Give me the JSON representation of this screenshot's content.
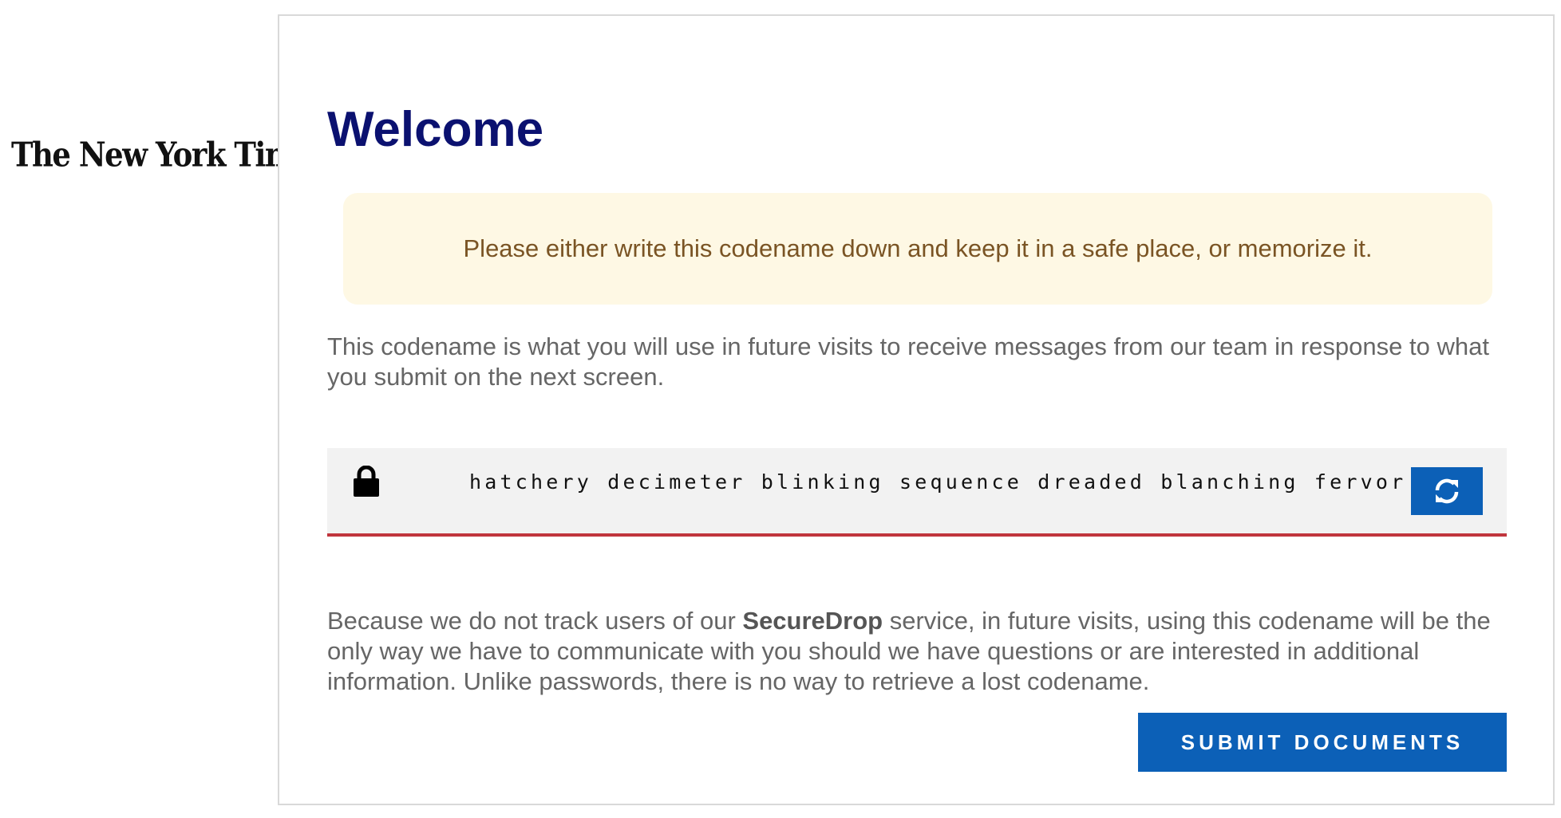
{
  "logo": {
    "text": "The New York Times"
  },
  "header": {
    "title": "Welcome"
  },
  "notice": {
    "text": "Please either write this codename down and keep it in a safe place, or memorize it."
  },
  "intro": {
    "text": "This codename is what you will use in future visits to receive messages from our team in response to what you submit on the next screen."
  },
  "codename": {
    "value": "hatchery decimeter blinking sequence dreaded blanching fervor",
    "lock_icon": "lock-icon",
    "refresh_icon": "refresh-icon"
  },
  "explanation": {
    "before": "Because we do not track users of our ",
    "brand": "SecureDrop",
    "after": " service, in future visits, using this codename will be the only way we have to communicate with you should we have questions or are interested in additional information. Unlike passwords, there is no way to retrieve a lost codename."
  },
  "actions": {
    "submit_label": "SUBMIT DOCUMENTS"
  },
  "colors": {
    "heading": "#0b1170",
    "notice_bg": "#fef8e4",
    "notice_text": "#7a5424",
    "button": "#0c60b7",
    "codename_underline": "#c0353d"
  }
}
